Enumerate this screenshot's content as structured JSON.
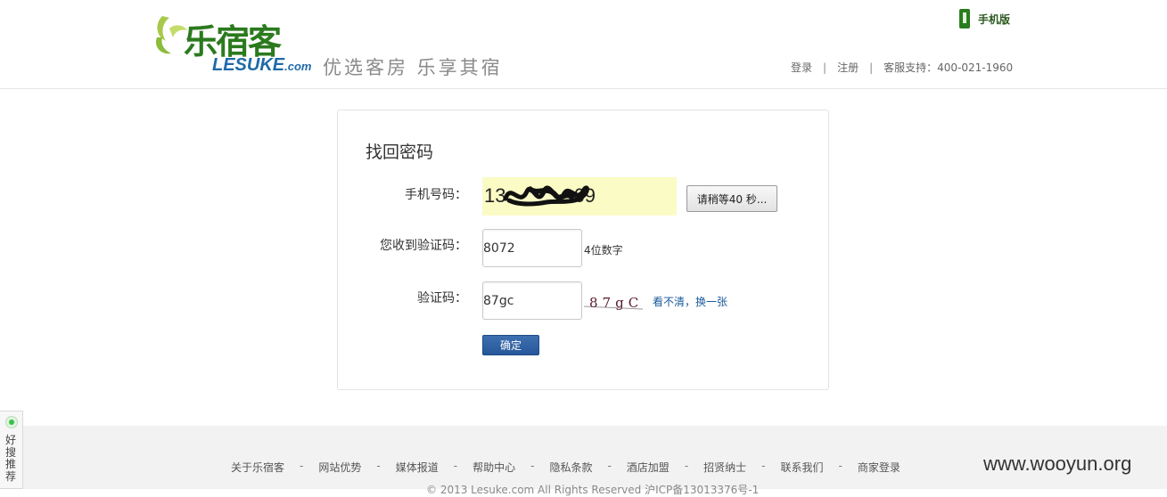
{
  "header": {
    "logo_cn": "乐宿客",
    "logo_en": "LESUKE",
    "logo_en_suffix": ".com",
    "slogan": "优选客房 乐享其宿",
    "mobile_label": "手机版",
    "links": {
      "login": "登录",
      "register": "注册",
      "support": "客服支持：400-021-1960",
      "separator": "|"
    }
  },
  "form": {
    "title": "找回密码",
    "phone_label": "手机号码：",
    "phone_value": "13",
    "phone_value_tail": "69",
    "wait_button": "请稍等40 秒...",
    "sms_code_label": "您收到验证码：",
    "sms_code_value": "8072",
    "sms_code_hint": "4位数字",
    "captcha_label": "验证码：",
    "captcha_value": "87gc",
    "captcha_image_text": "87gC",
    "captcha_refresh": "看不清，换一张",
    "confirm_button": "确定"
  },
  "footer": {
    "links": [
      "关于乐宿客",
      "网站优势",
      "媒体报道",
      "帮助中心",
      "隐私条款",
      "酒店加盟",
      "招贤纳士",
      "联系我们",
      "商家登录"
    ],
    "separator": "-",
    "copyright": "© 2013 Lesuke.com  All Rights Reserved 沪ICP备13013376号-1"
  },
  "watermark": "www.wooyun.org",
  "side_tab": {
    "label": "好搜推荐"
  },
  "colors": {
    "brand_green": "#2b7a1e",
    "brand_blue": "#1f6aa8",
    "button_blue": "#27579a",
    "phone_highlight": "#fbfbc6"
  }
}
